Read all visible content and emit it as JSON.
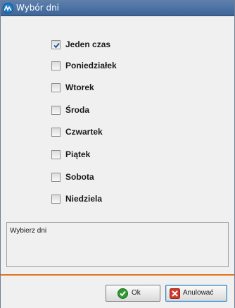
{
  "window": {
    "title": "Wybór dni",
    "icon": "app-logo-icon"
  },
  "days": [
    {
      "label": "Jeden czas",
      "checked": true
    },
    {
      "label": "Poniedziałek",
      "checked": false
    },
    {
      "label": "Wtorek",
      "checked": false
    },
    {
      "label": "Środa",
      "checked": false
    },
    {
      "label": "Czwartek",
      "checked": false
    },
    {
      "label": "Piątek",
      "checked": false
    },
    {
      "label": "Sobota",
      "checked": false
    },
    {
      "label": "Niedziela",
      "checked": false
    }
  ],
  "info": {
    "text": "Wybierz dni"
  },
  "buttons": {
    "ok_label": "Ok",
    "ok_icon": "check-circle-icon",
    "cancel_label": "Anulować",
    "cancel_icon": "close-icon"
  },
  "colors": {
    "title_bar": "#4a6fa3",
    "accent_line": "#e6731a",
    "ok_green": "#2f9a2f",
    "cancel_red": "#d23a2a"
  }
}
